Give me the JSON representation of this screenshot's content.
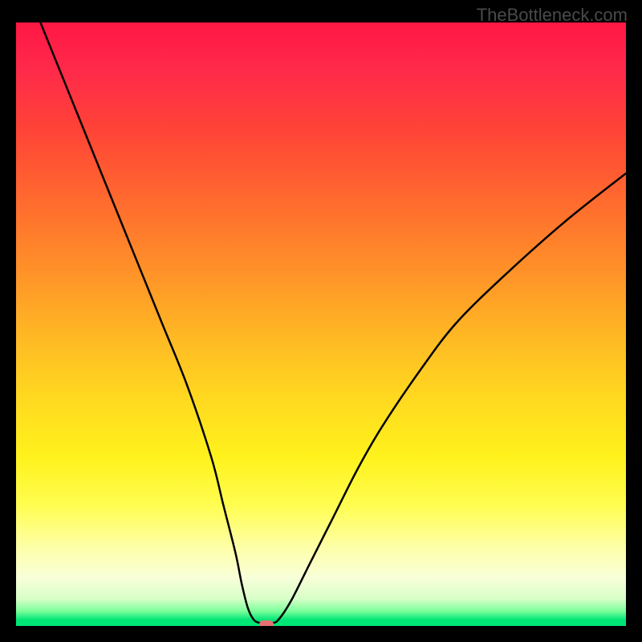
{
  "watermark": "TheBottleneck.com",
  "chart_data": {
    "type": "line",
    "title": "",
    "xlabel": "",
    "ylabel": "",
    "xlim": [
      0,
      100
    ],
    "ylim": [
      0,
      100
    ],
    "series": [
      {
        "name": "bottleneck-curve",
        "x": [
          4,
          8,
          12,
          16,
          20,
          24,
          28,
          32,
          34,
          36,
          37,
          38,
          39,
          40,
          41,
          42,
          43,
          45,
          48,
          52,
          56,
          60,
          66,
          72,
          80,
          90,
          100
        ],
        "y": [
          100,
          90,
          80,
          70,
          60,
          50,
          40,
          28,
          20,
          12,
          7,
          3,
          1,
          0.5,
          0.5,
          0.5,
          1,
          4,
          10,
          18,
          26,
          33,
          42,
          50,
          58,
          67,
          75
        ]
      }
    ],
    "marker": {
      "x": 41,
      "y": 0.2
    },
    "gradient_colors": {
      "top": "#ff1744",
      "mid": "#fff21c",
      "bottom": "#00e676"
    }
  }
}
